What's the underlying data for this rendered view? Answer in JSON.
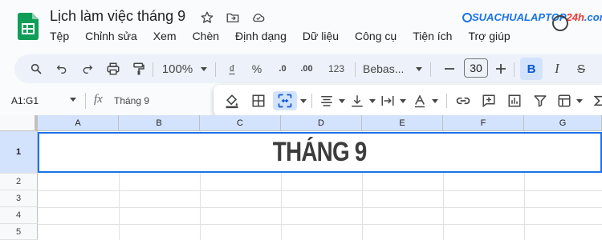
{
  "document": {
    "title": "Lịch làm việc tháng 9"
  },
  "menu": [
    "Tệp",
    "Chỉnh sửa",
    "Xem",
    "Chèn",
    "Định dạng",
    "Dữ liệu",
    "Công cụ",
    "Tiện ích",
    "Trợ giúp"
  ],
  "brand": {
    "text_main": "SUACHUALAPTOP",
    "text_highlight": "24h",
    "text_suffix": ".com"
  },
  "toolbar": {
    "zoom": "100%",
    "currency": "₫",
    "percent": "%",
    "decrease_decimal": ".0",
    "increase_decimal": ".00",
    "number_format": "123",
    "font": "Bebas...",
    "font_size": "30",
    "bold": "B",
    "italic": "I",
    "strike": "S"
  },
  "formula_bar": {
    "name_box": "A1:G1",
    "fx": "fx",
    "value": "Tháng 9"
  },
  "sheet": {
    "columns": [
      "A",
      "B",
      "C",
      "D",
      "E",
      "F",
      "G"
    ],
    "rows": [
      "1",
      "2",
      "3",
      "4",
      "5"
    ],
    "merged_cell_text": "THÁNG 9",
    "selection_color": "#1a73e8",
    "header_highlight": "#d3e3fd"
  },
  "colors": {
    "brand_blue": "#1a73e8",
    "brand_red": "#e53935",
    "sheets_green": "#0f9d58"
  }
}
